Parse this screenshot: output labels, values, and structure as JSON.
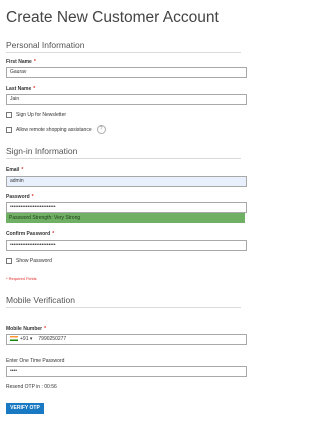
{
  "page": {
    "title": "Create New Customer Account"
  },
  "personal": {
    "heading": "Personal Information",
    "first_name_label": "First Name",
    "first_name_value": "Gaurav",
    "last_name_label": "Last Name",
    "last_name_value": "Jain",
    "newsletter_label": "Sign Up for Newsletter",
    "remote_assist_label": "Allow remote shopping assistance",
    "help_icon": "?"
  },
  "signin": {
    "heading": "Sign-in Information",
    "email_label": "Email",
    "email_value": "admin",
    "password_label": "Password",
    "password_value": "••••••••••••••••••••••••••",
    "strength_text": "Password Strength: Very Strong",
    "confirm_label": "Confirm Password",
    "confirm_value": "••••••••••••••••••••••••••",
    "show_password_label": "Show Password"
  },
  "required_note": "* Required Fields",
  "required_marker": "*",
  "mobile": {
    "heading": "Mobile Verification",
    "mobile_label": "Mobile Number",
    "dial_code": "+91 ▾",
    "mobile_value": "7990250277",
    "otp_label": "Enter One Time Password",
    "otp_value": "••••",
    "resend_text": "Resend OTP in : 00:56",
    "verify_button": "VERIFY OTP"
  },
  "colors": {
    "accent": "#1979c3",
    "strength_bar": "#70b065",
    "required": "#e02b27"
  },
  "icons": [
    "help-icon",
    "india-flag-icon"
  ]
}
